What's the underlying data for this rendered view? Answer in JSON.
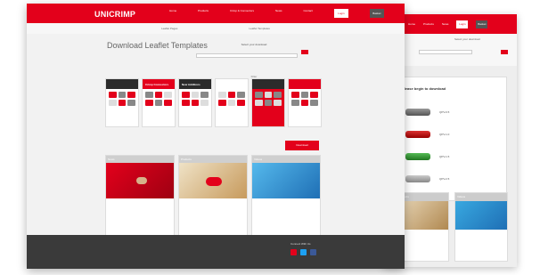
{
  "front": {
    "header": {
      "logo": "UNICRIMP",
      "logo_sub": "",
      "nav": [
        "Home",
        "Products",
        "Crimp & Connectors",
        "News",
        "Contact"
      ],
      "buttons": [
        "Login",
        "Basket"
      ]
    },
    "breadcrumbs": [
      "Leaflet Pages",
      "Leaflet Templates"
    ],
    "intro": {
      "title": "Download Leaflet Templates"
    },
    "download": {
      "title": "Select your download",
      "filter": "Filter"
    },
    "thumbnails": [
      {
        "title": ""
      },
      {
        "title": "Crimp Connectors"
      },
      {
        "title": "New Additions"
      },
      {
        "title": ""
      },
      {
        "title": ""
      },
      {
        "title": ""
      }
    ],
    "download_button": "Download",
    "news": [
      {
        "tag": "News"
      },
      {
        "tag": "Products"
      },
      {
        "tag": "Videos"
      }
    ],
    "footer": {
      "connect": "Connect With Us"
    }
  },
  "back": {
    "header_nav": [
      "Home",
      "Products",
      "News"
    ],
    "panel_title": "Please begin to download",
    "products": [
      "QPV-0.5",
      "QPV-1.0",
      "QPV-1.5",
      "QPV-2.5"
    ]
  },
  "colors": {
    "brand_red": "#e3001b",
    "footer_dark": "#3a3a3a"
  }
}
